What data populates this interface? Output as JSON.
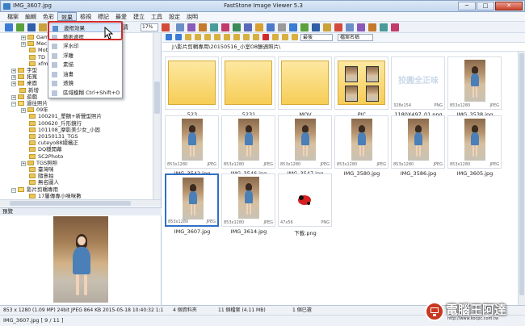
{
  "window": {
    "title_left": "IMG_3607.jpg",
    "title": "FastStone Image Viewer 5.3",
    "min_label": "─",
    "max_label": "□",
    "close_label": "✕"
  },
  "menubar": [
    "檔案",
    "編輯",
    "色彩",
    "效果",
    "檢視",
    "標記",
    "最愛",
    "建立",
    "工具",
    "設定",
    "說明"
  ],
  "toolbar": {
    "zoom": "17%",
    "page_partial": "清"
  },
  "effects_menu": {
    "items": [
      {
        "label": "邊框效果"
      },
      {
        "label": "藝術邊框"
      },
      {
        "label": "浮水印"
      },
      {
        "label": "浮雕"
      },
      {
        "label": "素描"
      },
      {
        "label": "油畫"
      },
      {
        "label": "透鏡"
      },
      {
        "label": "區域模糊  Ctrl+Shift+O"
      }
    ]
  },
  "tree": {
    "items": [
      {
        "label": "Gam",
        "indent": 2,
        "open": false,
        "expander": "+"
      },
      {
        "label": "Mec",
        "indent": 2,
        "open": false,
        "expander": "+"
      },
      {
        "label": "Moti",
        "indent": 2,
        "open": false,
        "expander": ""
      },
      {
        "label": "TD",
        "indent": 2,
        "open": false,
        "expander": ""
      },
      {
        "label": "xfmc",
        "indent": 2,
        "open": false,
        "expander": ""
      },
      {
        "label": "字型",
        "indent": 1,
        "open": false,
        "expander": "+"
      },
      {
        "label": "拓寬",
        "indent": 1,
        "open": false,
        "expander": "+"
      },
      {
        "label": "桌面",
        "indent": 1,
        "open": false,
        "expander": "+"
      },
      {
        "label": "新增",
        "indent": 1,
        "open": false,
        "expander": ""
      },
      {
        "label": "遊戲",
        "indent": 1,
        "open": false,
        "expander": "+"
      },
      {
        "label": "過往照片",
        "indent": 1,
        "open": true,
        "expander": "−"
      },
      {
        "label": "09年",
        "indent": 2,
        "open": false,
        "expander": "+"
      },
      {
        "label": "100201_墾鵝+新聲型照片",
        "indent": 2,
        "open": false,
        "expander": ""
      },
      {
        "label": "100620_斤形鏡行",
        "indent": 2,
        "open": false,
        "expander": ""
      },
      {
        "label": "101108_摩影美少女_小固",
        "indent": 2,
        "open": false,
        "expander": ""
      },
      {
        "label": "20150131_TGS",
        "indent": 2,
        "open": false,
        "expander": ""
      },
      {
        "label": "cuteyo88總攝正",
        "indent": 2,
        "open": false,
        "expander": ""
      },
      {
        "label": "DQ穩開幕",
        "indent": 2,
        "open": false,
        "expander": ""
      },
      {
        "label": "SC2Photo",
        "indent": 2,
        "open": false,
        "expander": ""
      },
      {
        "label": "TGS照照",
        "indent": 2,
        "open": false,
        "expander": "+"
      },
      {
        "label": "臺灣咪",
        "indent": 2,
        "open": false,
        "expander": ""
      },
      {
        "label": "隨意拍",
        "indent": 2,
        "open": false,
        "expander": ""
      },
      {
        "label": "無名圖人",
        "indent": 2,
        "open": false,
        "expander": ""
      },
      {
        "label": "影片剪輯專用",
        "indent": 1,
        "open": true,
        "expander": "−"
      },
      {
        "label": "17屢傳專小咪咪數",
        "indent": 2,
        "open": false,
        "expander": ""
      }
    ]
  },
  "preview": {
    "header": "預覽",
    "info": "853 x 1280 (1.09 MP)  24bit  JPEG  864 KB  2015-05-18 10:40:32  1:1",
    "file": "IMG_3607.jpg [ 9 / 11 ]"
  },
  "file_pane": {
    "sort_label": "最後",
    "sort_by": "檔案名稱",
    "path": "J:\\影片剪輯專用\\20150516_小室O8酬週照片\\",
    "tiles": [
      {
        "name": "523",
        "kind": "folder",
        "meta_l": "",
        "meta_r": ""
      },
      {
        "name": "5231",
        "kind": "folder",
        "meta_l": "",
        "meta_r": ""
      },
      {
        "name": "MOV",
        "kind": "folder",
        "meta_l": "",
        "meta_r": ""
      },
      {
        "name": "PIC",
        "kind": "pic",
        "meta_l": "",
        "meta_r": ""
      },
      {
        "name": "1180X497_01.png",
        "kind": "logo",
        "meta_l": "328x154",
        "meta_r": "PNG"
      },
      {
        "name": "IMG_3538.jpg",
        "kind": "photo",
        "meta_l": "853x1280",
        "meta_r": "JPEG"
      },
      {
        "name": "IMG_3542.jpg",
        "kind": "photo",
        "meta_l": "853x1280",
        "meta_r": "JPEG"
      },
      {
        "name": "IMG_3546.jpg",
        "kind": "photo",
        "meta_l": "853x1280",
        "meta_r": "JPEG"
      },
      {
        "name": "IMG_3547.jpg",
        "kind": "photo",
        "meta_l": "853x1280",
        "meta_r": "JPEG"
      },
      {
        "name": "IMG_3580.jpg",
        "kind": "photo",
        "meta_l": "853x1280",
        "meta_r": "JPEG"
      },
      {
        "name": "IMG_3586.jpg",
        "kind": "photo",
        "meta_l": "853x1280",
        "meta_r": "JPEG"
      },
      {
        "name": "IMG_3605.jpg",
        "kind": "photo",
        "meta_l": "853x1280",
        "meta_r": "JPEG"
      },
      {
        "name": "IMG_3607.jpg",
        "kind": "photo",
        "meta_l": "853x1280",
        "meta_r": "JPEG",
        "selected": true
      },
      {
        "name": "IMG_3614.jpg",
        "kind": "photo",
        "meta_l": "853x1280",
        "meta_r": "JPEG"
      },
      {
        "name": "下載.png",
        "kind": "small",
        "meta_l": "47x56",
        "meta_r": "PNG"
      }
    ],
    "logo_text": "狡圓全正味"
  },
  "status": {
    "folders": "4 個資料夾",
    "files": "11 個檔案 (4.11 MB)",
    "selected": "1 個已選"
  },
  "watermark": {
    "text": "電腦王阿達",
    "url": "http://www.kocpc.com.tw"
  },
  "colors": {
    "accent": "#2f6fc8",
    "highlight": "#d12a2a",
    "folder": "#f6cd57"
  }
}
